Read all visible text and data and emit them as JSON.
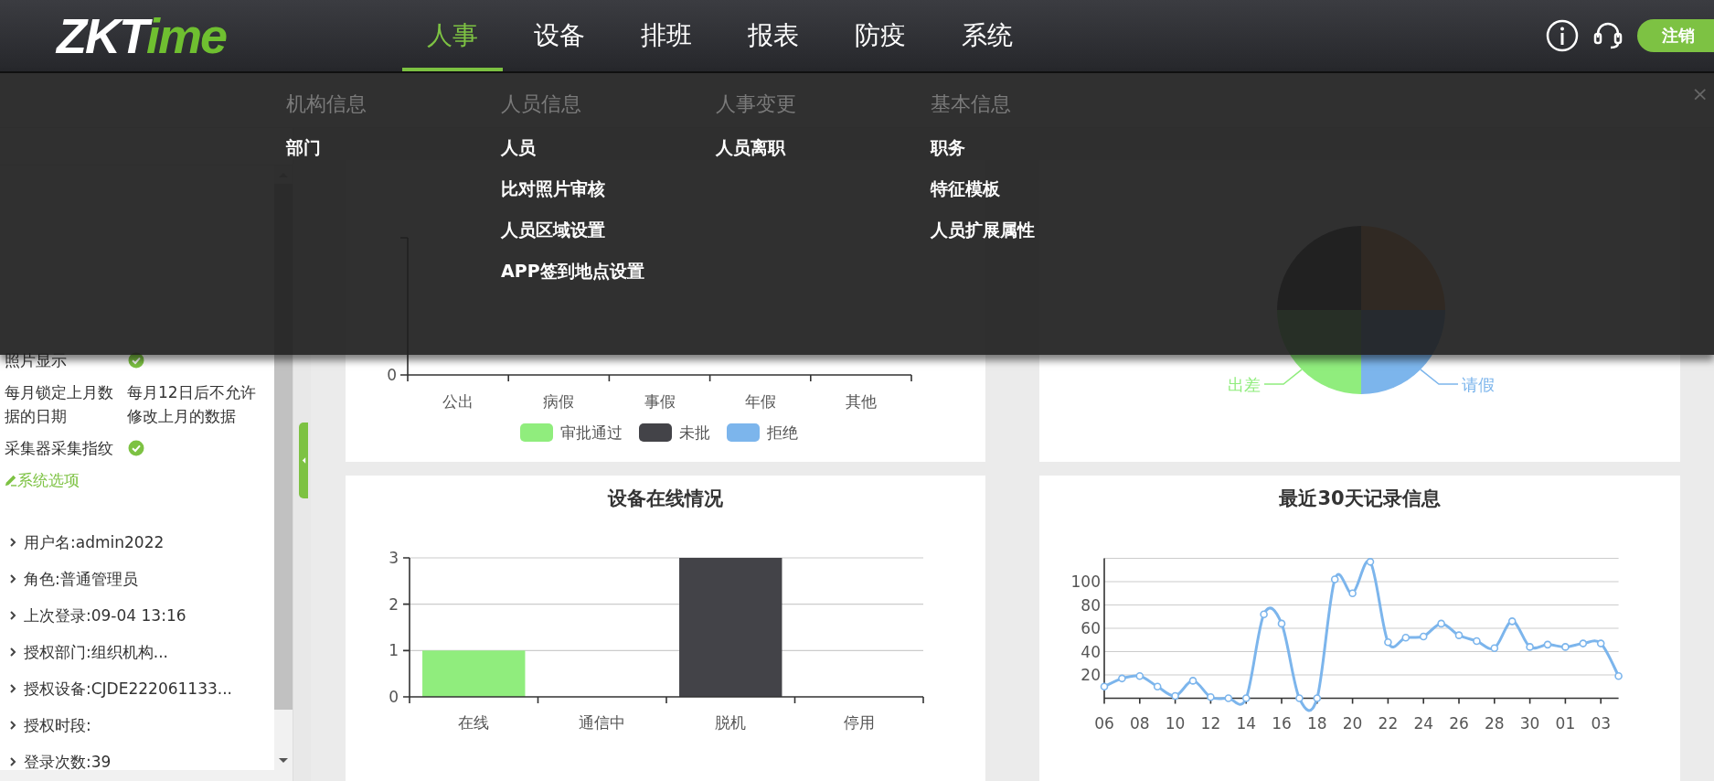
{
  "header": {
    "logo": {
      "lead": "ZKT",
      "tail": "ime"
    },
    "nav": [
      {
        "label": "人事",
        "selected": true
      },
      {
        "label": "设备",
        "selected": false
      },
      {
        "label": "排班",
        "selected": false
      },
      {
        "label": "报表",
        "selected": false
      },
      {
        "label": "防疫",
        "selected": false
      },
      {
        "label": "系统",
        "selected": false
      }
    ],
    "logout": "注销"
  },
  "menu": {
    "close": "×",
    "columns": [
      {
        "heading": "机构信息",
        "items": [
          "部门"
        ]
      },
      {
        "heading": "人员信息",
        "items": [
          "人员",
          "比对照片审核",
          "人员区域设置",
          "APP签到地点设置"
        ]
      },
      {
        "heading": "人事变更",
        "items": [
          "人员离职"
        ]
      },
      {
        "heading": "基本信息",
        "items": [
          "职务",
          "特征模板",
          "人员扩展属性"
        ]
      }
    ]
  },
  "sidebar": {
    "options": [
      {
        "kind": "check",
        "label": "照片显示",
        "on": true
      },
      {
        "kind": "text",
        "label": "每月锁定上月数据的日期",
        "value": "每月12日后不允许修改上月的数据"
      },
      {
        "kind": "check",
        "label": "采集器采集指纹",
        "on": true
      }
    ],
    "options_link": "系统选项",
    "info": [
      "用户名:admin2022",
      "角色:普通管理员",
      "上次登录:09-04 13:16",
      "授权部门:组织机构...",
      "授权设备:CJDE222061133...",
      "授权时段:",
      "登录次数:39"
    ]
  },
  "leave_card": {
    "axis_label": "0",
    "categories": [
      "公出",
      "病假",
      "事假",
      "年假",
      "其他"
    ],
    "legend": [
      {
        "name": "审批通过",
        "color": "#90ed7d"
      },
      {
        "name": "未批",
        "color": "#434348"
      },
      {
        "name": "拒绝",
        "color": "#7cb5ec"
      }
    ]
  },
  "presence_card": {
    "slices": [
      {
        "label": "出差",
        "color": "#90ed7d"
      },
      {
        "label": "请假",
        "color": "#7cb5ec"
      }
    ]
  },
  "device_card": {
    "chart_data": {
      "type": "bar",
      "title": "设备在线情况",
      "categories": [
        "在线",
        "通信中",
        "脱机",
        "停用"
      ],
      "values": [
        1,
        0,
        3,
        0
      ],
      "colors": [
        "#90ed7d",
        "#7cb5ec",
        "#434348",
        "#f7a35c"
      ],
      "ylim": [
        0,
        3
      ],
      "yticks": [
        0,
        1,
        2,
        3
      ],
      "grid": true
    }
  },
  "records_card": {
    "chart_data": {
      "type": "line",
      "title": "最近30天记录信息",
      "categories": [
        "06",
        null,
        "08",
        null,
        "10",
        null,
        "12",
        null,
        "14",
        null,
        "16",
        null,
        "18",
        null,
        "20",
        null,
        "22",
        null,
        "24",
        null,
        "26",
        null,
        "28",
        null,
        "30",
        null,
        "01",
        null,
        "03",
        null
      ],
      "series": [
        {
          "color": "#7cb5ec",
          "marker": true,
          "values": [
            10,
            17,
            19,
            10,
            2,
            15,
            1,
            0,
            0,
            72,
            64,
            0,
            0,
            102,
            90,
            117,
            48,
            52,
            53,
            64,
            54,
            49,
            43,
            66,
            44,
            46,
            44,
            47,
            47,
            19
          ]
        }
      ],
      "ylim": [
        0,
        120
      ],
      "yticks": [
        20,
        40,
        60,
        80,
        100
      ],
      "grid": true
    }
  }
}
